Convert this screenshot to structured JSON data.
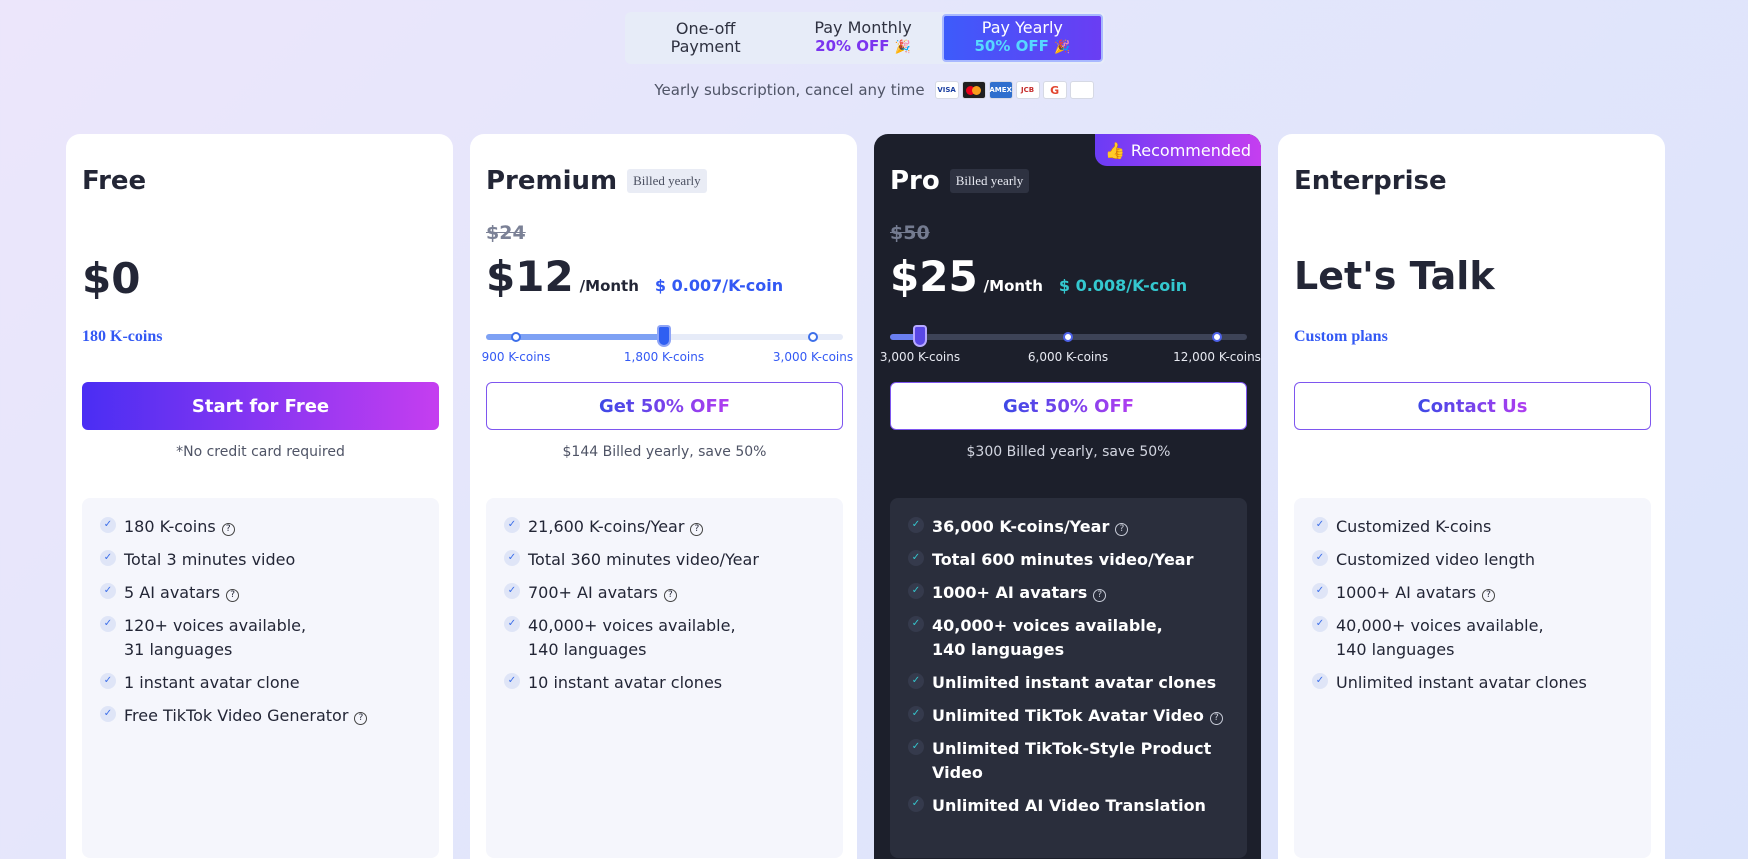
{
  "toggle": {
    "options": [
      {
        "line1": "One-off",
        "line2": "Payment"
      },
      {
        "line1": "Pay Monthly",
        "line2": "20% OFF",
        "emoji": "🎉"
      },
      {
        "line1": "Pay Yearly",
        "line2": "50% OFF",
        "emoji": "🎉"
      }
    ],
    "active_index": 2
  },
  "subline": {
    "text": "Yearly subscription, cancel any time",
    "payment_methods": [
      "VISA",
      "Mastercard",
      "AMEX",
      "JCB",
      "Google Pay",
      "Apple Pay"
    ]
  },
  "cards": [
    {
      "title": "Free",
      "price": "$0",
      "kcoins": "180 K-coins",
      "cta": "Start for Free",
      "note": "*No credit card required",
      "features": [
        "180 K-coins",
        "Total 3 minutes video",
        "5 AI avatars",
        "120+ voices available,\n31 languages",
        "1 instant avatar clone",
        "Free TikTok Video Generator"
      ]
    },
    {
      "title": "Premium",
      "badge": "Billed yearly",
      "old_price": "$24",
      "price": "$12",
      "per": "/Month",
      "rate": "$ 0.007/K-coin",
      "slider": {
        "ticks": [
          "900 K-coins",
          "1,800 K-coins",
          "3,000 K-coins"
        ],
        "selected_index": 1
      },
      "cta": "Get 50% OFF",
      "note": "$144 Billed yearly, save 50%",
      "features": [
        "21,600 K-coins/Year",
        "Total 360 minutes video/Year",
        "700+ AI avatars",
        "40,000+ voices available,\n140 languages",
        "10 instant avatar clones"
      ]
    },
    {
      "title": "Pro",
      "badge": "Billed yearly",
      "recommended": "Recommended",
      "old_price": "$50",
      "price": "$25",
      "per": "/Month",
      "rate": "$ 0.008/K-coin",
      "slider": {
        "ticks": [
          "3,000 K-coins",
          "6,000 K-coins",
          "12,000 K-coins"
        ],
        "selected_index": 0
      },
      "cta": "Get 50% OFF",
      "note": "$300 Billed yearly, save 50%",
      "features": [
        "36,000 K-coins/Year",
        "Total 600 minutes video/Year",
        "1000+ AI avatars",
        "40,000+ voices available,\n140 languages",
        "Unlimited instant avatar clones",
        "Unlimited TikTok Avatar Video",
        "Unlimited TikTok-Style Product Video",
        "Unlimited AI Video Translation"
      ]
    },
    {
      "title": "Enterprise",
      "price": "Let's Talk",
      "kcoins": "Custom plans",
      "cta": "Contact Us",
      "features": [
        "Customized K-coins",
        "Customized video length",
        "1000+ AI avatars",
        "40,000+ voices available,\n140 languages",
        "Unlimited instant avatar clones"
      ]
    }
  ]
}
